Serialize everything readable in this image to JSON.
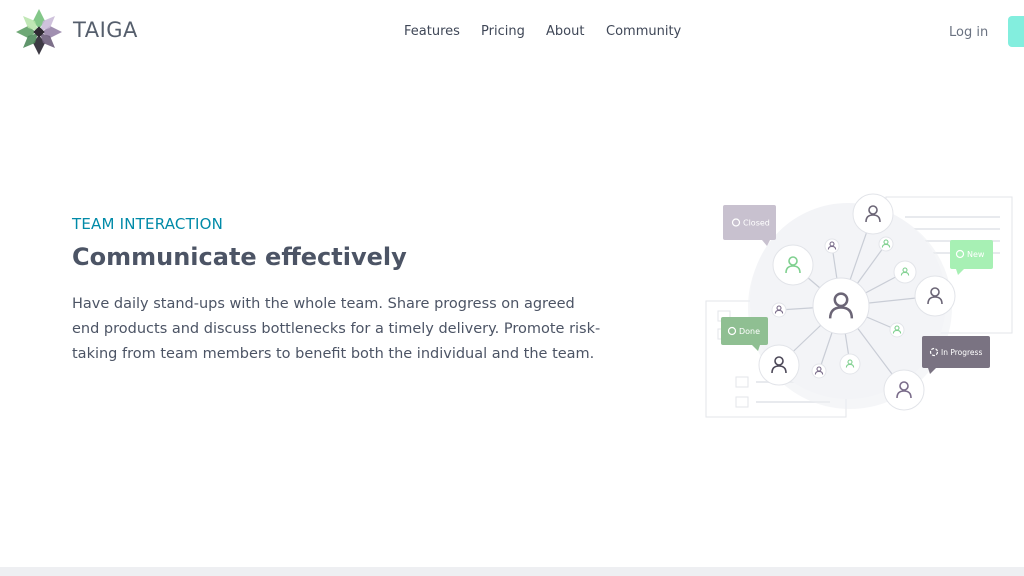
{
  "brand": {
    "name": "TAIGA"
  },
  "nav": {
    "items": [
      {
        "label": "Features"
      },
      {
        "label": "Pricing"
      },
      {
        "label": "About"
      },
      {
        "label": "Community"
      }
    ],
    "login_label": "Log in"
  },
  "hero": {
    "eyebrow": "TEAM INTERACTION",
    "title": "Communicate effectively",
    "description": "Have daily stand-ups with the whole team. Share progress on agreed end products and discuss bottlenecks for a timely delivery. Promote risk-taking from team members to benefit both the individual and the team."
  },
  "illustration": {
    "tags": {
      "closed": "Closed",
      "new": "New",
      "done": "Done",
      "in_progress": "In Progress"
    }
  },
  "colors": {
    "accent": "#008aa8",
    "signup": "#83eede",
    "heading": "#4c5465"
  }
}
